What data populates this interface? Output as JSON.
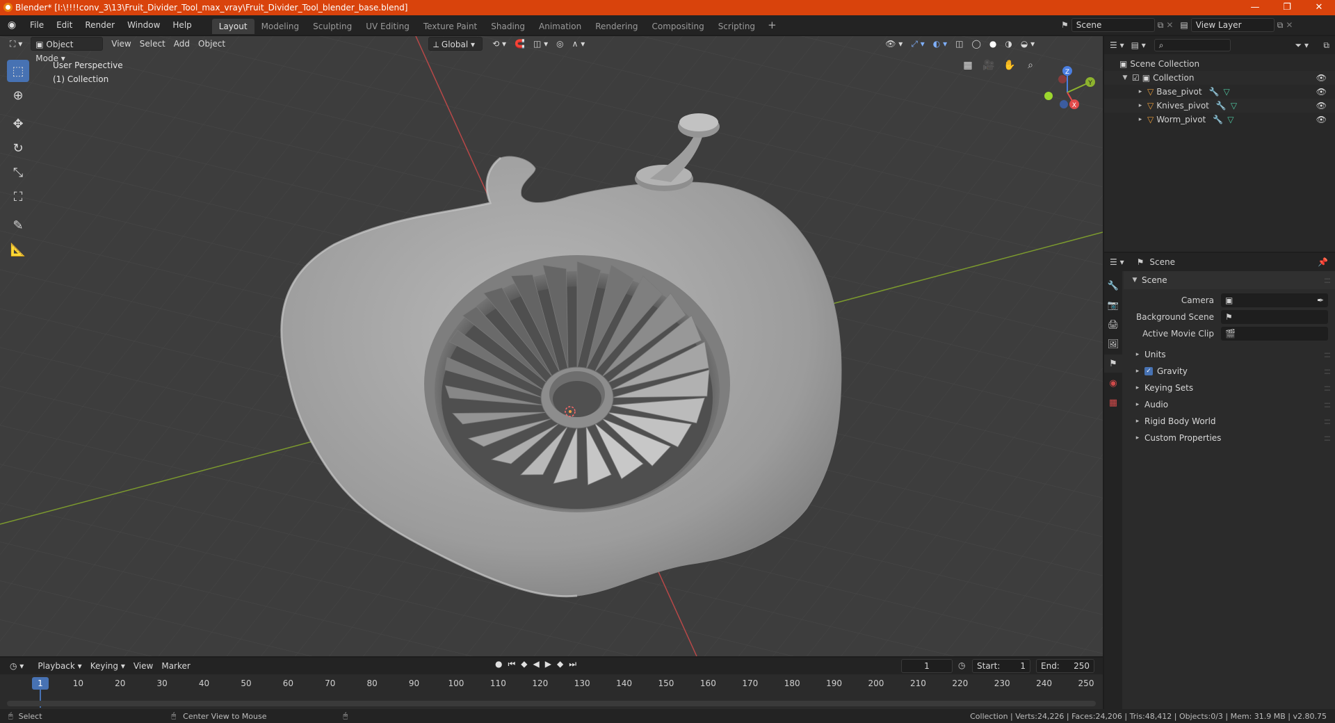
{
  "titlebar": {
    "title": "Blender* [I:\\!!!!conv_3\\13\\Fruit_Divider_Tool_max_vray\\Fruit_Divider_Tool_blender_base.blend]",
    "minimize": "—",
    "maximize": "❐",
    "close": "✕"
  },
  "menu": [
    "File",
    "Edit",
    "Render",
    "Window",
    "Help"
  ],
  "workspaces": [
    "Layout",
    "Modeling",
    "Sculpting",
    "UV Editing",
    "Texture Paint",
    "Shading",
    "Animation",
    "Rendering",
    "Compositing",
    "Scripting"
  ],
  "active_workspace": "Layout",
  "scene_selector": "Scene",
  "view_layer": "View Layer",
  "viewport_header": {
    "mode": "Object Mode",
    "view": "View",
    "select": "Select",
    "add": "Add",
    "object": "Object",
    "transform": "Global"
  },
  "overlay_text": {
    "perspective": "User Perspective",
    "collection": "(1) Collection"
  },
  "axes": {
    "z": "Z",
    "y": "Y",
    "x": "X"
  },
  "colors": {
    "accent": "#4772b3",
    "titlebar": "#d9430c",
    "x_axis": "#e24a4a",
    "y_axis": "#8db32e",
    "z_axis": "#4a7fe2",
    "object": "#e89c3b"
  },
  "outliner": {
    "root": "Scene Collection",
    "collection": "Collection",
    "objects": [
      "Base_pivot",
      "Knives_pivot",
      "Worm_pivot"
    ]
  },
  "properties": {
    "header": "Scene",
    "section": "Scene",
    "camera_label": "Camera",
    "background_label": "Background Scene",
    "movie_clip_label": "Active Movie Clip",
    "panels": [
      "Units",
      "Gravity",
      "Keying Sets",
      "Audio",
      "Rigid Body World",
      "Custom Properties"
    ]
  },
  "timeline": {
    "playback": "Playback",
    "keying": "Keying",
    "view": "View",
    "marker": "Marker",
    "current_frame": "1",
    "start_label": "Start:",
    "start": "1",
    "end_label": "End:",
    "end": "250",
    "ticks": [
      "10",
      "20",
      "30",
      "40",
      "50",
      "60",
      "70",
      "80",
      "90",
      "100",
      "110",
      "120",
      "130",
      "140",
      "150",
      "160",
      "170",
      "180",
      "190",
      "200",
      "210",
      "220",
      "230",
      "240",
      "250"
    ],
    "cursor_frame": "1"
  },
  "statusbar": {
    "left": "Select",
    "middle": "Center View to Mouse",
    "right": "Collection | Verts:24,226 | Faces:24,206 | Tris:48,412 | Objects:0/3 | Mem: 31.9 MB | v2.80.75"
  }
}
